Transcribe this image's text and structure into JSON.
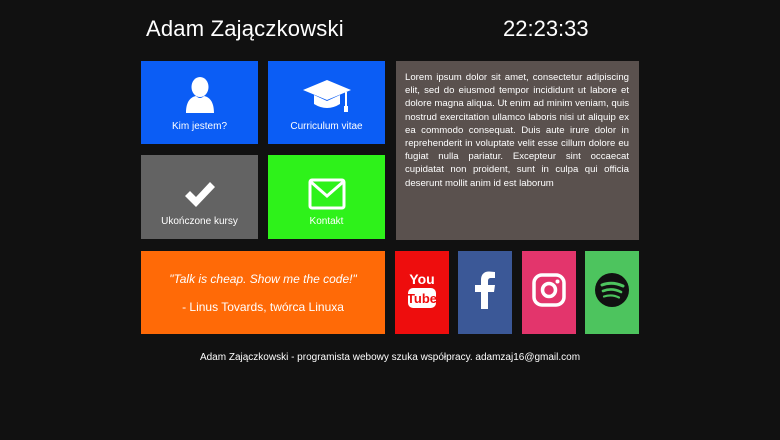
{
  "header": {
    "name": "Adam Zajączkowski",
    "clock": "22:23:33"
  },
  "tiles": {
    "about": {
      "label": "Kim jestem?",
      "icon": "user-icon",
      "color": "#0b5df5"
    },
    "cv": {
      "label": "Curriculum vitae",
      "icon": "graduation-cap-icon",
      "color": "#0b5df5"
    },
    "courses": {
      "label": "Ukończone kursy",
      "icon": "checkmark-icon",
      "color": "#636363"
    },
    "contact": {
      "label": "Kontakt",
      "icon": "envelope-icon",
      "color": "#2ef21a"
    }
  },
  "lorem": {
    "text": "Lorem ipsum dolor sit amet, consectetur adipiscing elit, sed do eiusmod tempor incididunt ut labore et dolore magna aliqua. Ut enim ad minim veniam, quis nostrud exercitation ullamco laboris nisi ut aliquip ex ea commodo consequat. Duis aute irure dolor in reprehenderit in voluptate velit esse cillum dolore eu fugiat nulla pariatur. Excepteur sint occaecat cupidatat non proident, sunt in culpa qui officia deserunt mollit anim id est laborum",
    "color": "#5a514e"
  },
  "quote": {
    "text": "\"Talk is cheap. Show me the code!\"",
    "author": "- Linus Tovards, twórca Linuxa",
    "color": "#ff6a07"
  },
  "social": {
    "youtube": {
      "icon": "youtube-icon",
      "color": "#ee0d0d"
    },
    "facebook": {
      "icon": "facebook-icon",
      "color": "#3b5897"
    },
    "instagram": {
      "icon": "instagram-icon",
      "color": "#e3356c"
    },
    "spotify": {
      "icon": "spotify-icon",
      "color": "#4dc45e"
    }
  },
  "footer": {
    "text": "Adam Zajączkowski - programista webowy szuka współpracy. adamzaj16@gmail.com"
  }
}
